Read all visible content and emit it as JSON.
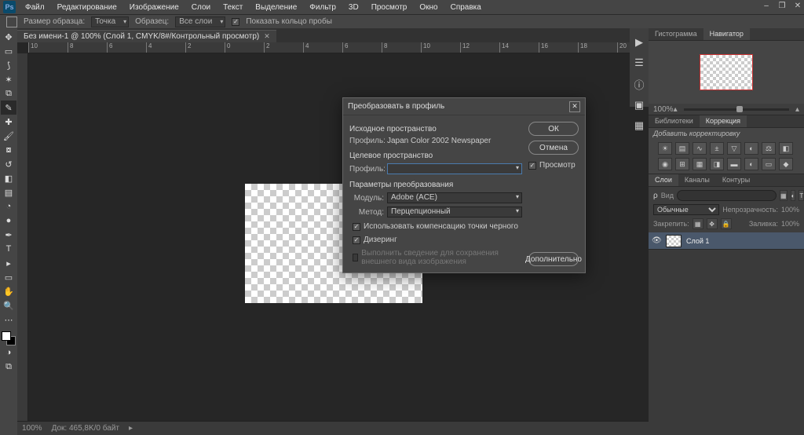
{
  "app": {
    "logo": "Ps"
  },
  "menu": {
    "items": [
      "Файл",
      "Редактирование",
      "Изображение",
      "Слои",
      "Текст",
      "Выделение",
      "Фильтр",
      "3D",
      "Просмотр",
      "Окно",
      "Справка"
    ]
  },
  "options": {
    "sample_size_label": "Размер образца:",
    "sample_size_value": "Точка",
    "sample_label": "Образец:",
    "sample_value": "Все слои",
    "show_ring_label": "Показать кольцо пробы"
  },
  "document": {
    "tab_title": "Без имени-1 @ 100% (Слой 1, CMYK/8#/Контрольный просмотр)"
  },
  "ruler_marks": [
    "10",
    "8",
    "6",
    "4",
    "2",
    "0",
    "2",
    "4",
    "6",
    "8",
    "10",
    "12",
    "14",
    "16",
    "18",
    "20"
  ],
  "status": {
    "zoom": "100%",
    "doc_info": "Док: 465,8K/0 байт"
  },
  "panels": {
    "nav_tabs": {
      "histogram": "Гистограмма",
      "navigator": "Навигатор"
    },
    "nav_zoom": "100%",
    "lib_tabs": {
      "libraries": "Библиотеки",
      "adjustments": "Коррекция"
    },
    "adjust_hint": "Добавить корректировку",
    "layers_tabs": {
      "layers": "Слои",
      "channels": "Каналы",
      "paths": "Контуры"
    },
    "kind_label": "Вид",
    "blend_mode": "Обычные",
    "opacity_label": "Непрозрачность:",
    "opacity_value": "100%",
    "lock_label": "Закрепить:",
    "fill_label": "Заливка:",
    "fill_value": "100%",
    "layer1_name": "Слой 1"
  },
  "dialog": {
    "title": "Преобразовать в профиль",
    "source_space_title": "Исходное пространство",
    "profile_label": "Профиль:",
    "source_profile_value": "Japan Color 2002 Newspaper",
    "target_space_title": "Целевое пространство",
    "target_profile_value": "",
    "conv_params_title": "Параметры преобразования",
    "engine_label": "Модуль:",
    "engine_value": "Adobe (ACE)",
    "intent_label": "Метод:",
    "intent_value": "Перцепционный",
    "bpc_label": "Использовать компенсацию точки черного",
    "dither_label": "Дизеринг",
    "flatten_label": "Выполнить сведение для сохранения внешнего вида изображения",
    "ok": "ОК",
    "cancel": "Отмена",
    "preview": "Просмотр",
    "advanced": "Дополнительно"
  }
}
